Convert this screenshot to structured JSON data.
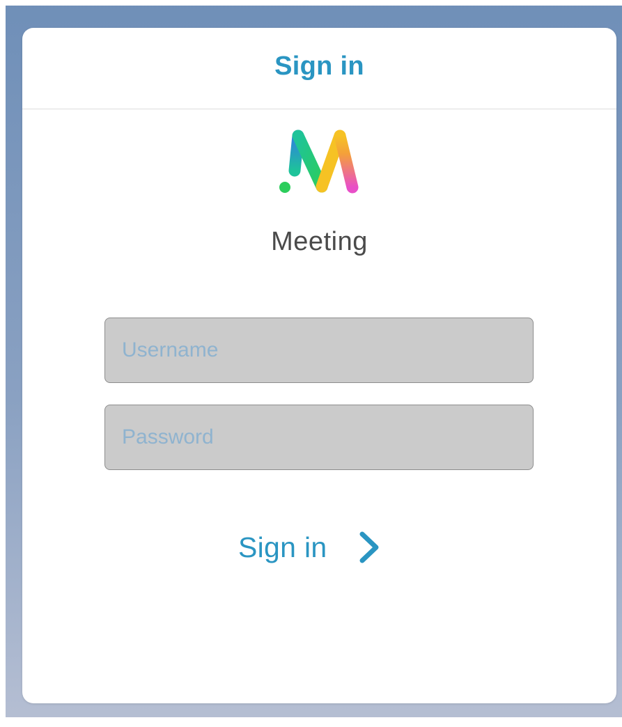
{
  "header": {
    "title": "Sign in"
  },
  "logo": {
    "letter": "M",
    "icon": "meeting-logo-icon",
    "colors": {
      "blue": "#2f7fe0",
      "teal": "#1ec39a",
      "green": "#2ccd5c",
      "yellow": "#f6c224",
      "pink": "#e84fc8"
    }
  },
  "app": {
    "name": "Meeting"
  },
  "form": {
    "username_placeholder": "Username",
    "password_placeholder": "Password",
    "username_value": "",
    "password_value": ""
  },
  "signin_button": {
    "label": "Sign in",
    "icon": "chevron-right-icon"
  },
  "theme": {
    "accent": "#2a95c2",
    "field_background": "#cbcbcb",
    "placeholder_color": "#8fb3cf"
  }
}
